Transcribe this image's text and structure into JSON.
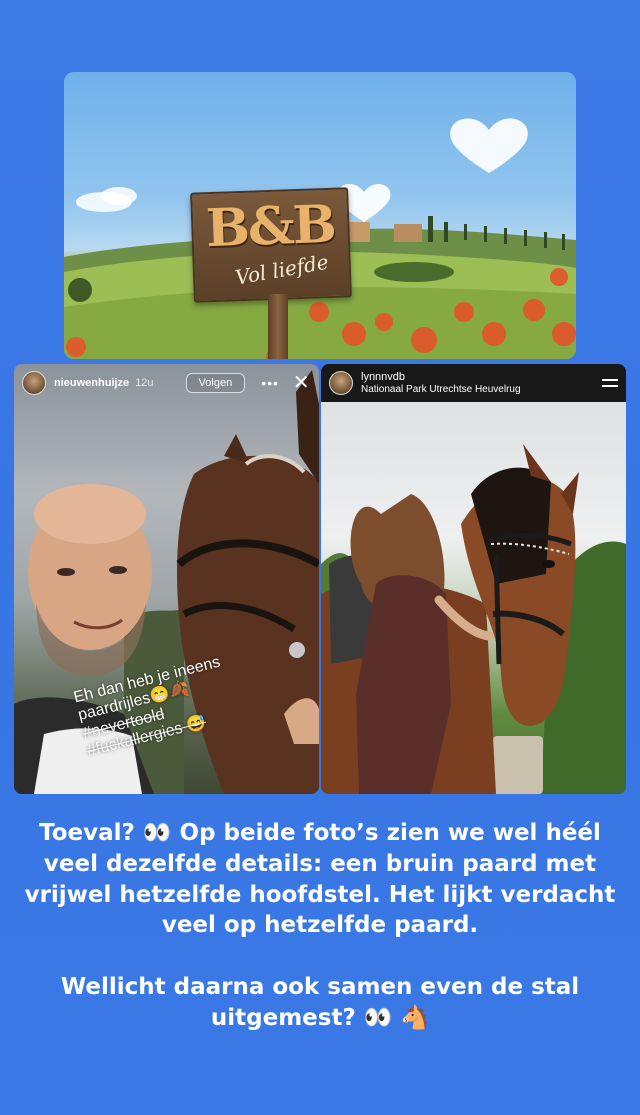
{
  "banner": {
    "sign_title": "B&B",
    "sign_subtitle": "Vol liefde"
  },
  "left_story": {
    "username": "nieuwenhuijze",
    "time": "12u",
    "follow_label": "Volgen",
    "more_icon": "more-horizontal-icon",
    "close_icon": "close-icon",
    "caption_lines": [
      "Eh dan heb je ineens",
      "paardrijles😁🍂",
      "#nevertoold",
      "#fuckallergies 😅"
    ]
  },
  "right_story": {
    "username": "lynnnvdb",
    "location": "Nationaal Park Utrechtse Heuvelrug",
    "menu_icon": "menu-icon"
  },
  "body": {
    "paragraph_1": "Toeval? 👀 Op beide foto’s zien we wel héél veel dezelfde details: een bruin paard met vrijwel hetzelfde hoofdstel. Het lijkt verdacht veel op hetzelfde paard.",
    "paragraph_2": "Wellicht daarna ook samen even de stal uitgemest? 👀 🐴"
  },
  "colors": {
    "background": "#3a78e6",
    "text": "#ffffff",
    "story_header_dark": "#181818"
  }
}
